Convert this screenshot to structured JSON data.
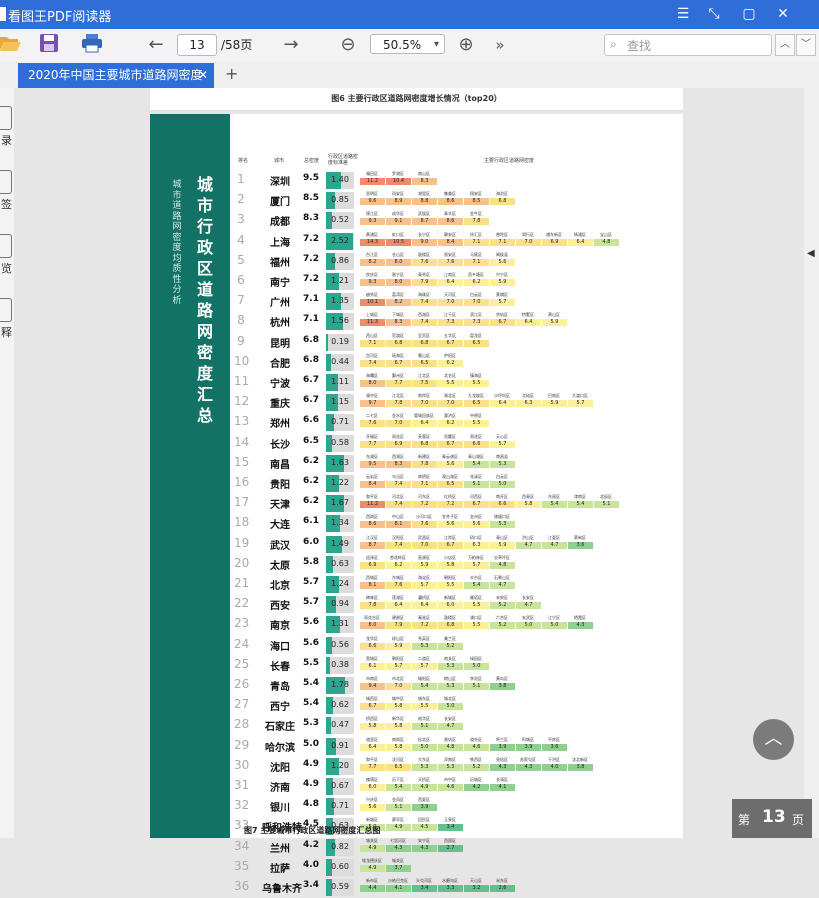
{
  "window": {
    "title": "看图王PDF阅读器",
    "minimize": "☰",
    "restore": "⤡",
    "maximize": "▢",
    "close": "✕"
  },
  "toolbar": {
    "open_icon": "folder-open-icon",
    "save_icon": "save-icon",
    "print_icon": "printer-icon",
    "back_glyph": "←",
    "forward_glyph": "→",
    "page_current": "13",
    "page_total": "/58页",
    "zoom_out_glyph": "⊖",
    "zoom_value": "50.5%",
    "zoom_caret": "▾",
    "zoom_in_glyph": "⊕",
    "more_glyph": "»",
    "search_placeholder": "查找",
    "search_glyph": "⌕",
    "search_prev": "︿",
    "search_next": "﹀"
  },
  "tabs": [
    {
      "label": "2020年中国主要城市道路网密度",
      "close": "✕"
    }
  ],
  "new_tab": "+",
  "sidebar": {
    "items": [
      {
        "label": "录"
      },
      {
        "label": "签"
      },
      {
        "label": "览"
      },
      {
        "label": "释"
      }
    ]
  },
  "document": {
    "upper_caption": "图6 主要行政区道路网密度增长情况（top20）",
    "band_title": "城市行政区道路网密度汇总",
    "band_subtitle": "城市道路网密度均质性分析",
    "headers": {
      "rank": "排名",
      "city": "城市",
      "total": "总密度",
      "dev": "行政区道路密度标准差",
      "districts": "主要行政区道路网密度"
    },
    "next_caption": "图7 主要城市行政区道路网密度汇总图",
    "rows": [
      {
        "rank": "1",
        "city": "深圳",
        "total": "9.5",
        "dev": "1.40",
        "districts": [
          [
            "福田区",
            "11.2"
          ],
          [
            "罗湖区",
            "10.4"
          ],
          [
            "南山区",
            "8.3"
          ]
        ]
      },
      {
        "rank": "2",
        "city": "厦门",
        "total": "8.5",
        "dev": "0.85",
        "districts": [
          [
            "思明区",
            "9.6"
          ],
          [
            "同安区",
            "8.9"
          ],
          [
            "湖里区",
            "8.8"
          ],
          [
            "集美区",
            "8.6"
          ],
          [
            "翔安区",
            "8.5"
          ],
          [
            "海沧区",
            "6.8"
          ]
        ]
      },
      {
        "rank": "3",
        "city": "成都",
        "total": "8.3",
        "dev": "0.52",
        "districts": [
          [
            "锦江区",
            "9.3"
          ],
          [
            "成华区",
            "9.1"
          ],
          [
            "武侯区",
            "8.7"
          ],
          [
            "青羊区",
            "8.6"
          ],
          [
            "金牛区",
            "7.8"
          ]
        ]
      },
      {
        "rank": "4",
        "city": "上海",
        "total": "7.2",
        "dev": "2.52",
        "districts": [
          [
            "黄浦区",
            "14.3"
          ],
          [
            "虹口区",
            "10.5"
          ],
          [
            "长宁区",
            "9.0"
          ],
          [
            "静安区",
            "8.4"
          ],
          [
            "徐汇区",
            "7.1"
          ],
          [
            "普陀区",
            "7.1"
          ],
          [
            "闵行区",
            "7.0"
          ],
          [
            "浦东新区",
            "6.9"
          ],
          [
            "杨浦区",
            "6.4"
          ],
          [
            "宝山区",
            "4.8"
          ]
        ]
      },
      {
        "rank": "5",
        "city": "福州",
        "total": "7.2",
        "dev": "0.86",
        "districts": [
          [
            "台江区",
            "8.2"
          ],
          [
            "仓山区",
            "8.0"
          ],
          [
            "鼓楼区",
            "7.6"
          ],
          [
            "晋安区",
            "7.6"
          ],
          [
            "马尾区",
            "7.1"
          ],
          [
            "闽侯县",
            "5.6"
          ]
        ]
      },
      {
        "rank": "6",
        "city": "南宁",
        "total": "7.2",
        "dev": "1.21",
        "districts": [
          [
            "良庆区",
            "9.3"
          ],
          [
            "邕宁区",
            "8.0"
          ],
          [
            "青秀区",
            "7.9"
          ],
          [
            "江南区",
            "6.4"
          ],
          [
            "西乡塘区",
            "6.2"
          ],
          [
            "兴宁区",
            "5.9"
          ]
        ]
      },
      {
        "rank": "7",
        "city": "广州",
        "total": "7.1",
        "dev": "1.35",
        "districts": [
          [
            "越秀区",
            "10.1"
          ],
          [
            "荔湾区",
            "8.2"
          ],
          [
            "海珠区",
            "7.4"
          ],
          [
            "天河区",
            "7.0"
          ],
          [
            "白云区",
            "7.0"
          ],
          [
            "黄埔区",
            "5.7"
          ]
        ]
      },
      {
        "rank": "8",
        "city": "杭州",
        "total": "7.1",
        "dev": "1.56",
        "districts": [
          [
            "上城区",
            "11.3"
          ],
          [
            "下城区",
            "8.3"
          ],
          [
            "西湖区",
            "7.4"
          ],
          [
            "江干区",
            "7.3"
          ],
          [
            "滨江区",
            "7.3"
          ],
          [
            "余杭区",
            "6.7"
          ],
          [
            "拱墅区",
            "6.4"
          ],
          [
            "萧山区",
            "5.9"
          ]
        ]
      },
      {
        "rank": "9",
        "city": "昆明",
        "total": "6.8",
        "dev": "0.19",
        "districts": [
          [
            "西山区",
            "7.1"
          ],
          [
            "官渡区",
            "6.8"
          ],
          [
            "呈贡区",
            "6.8"
          ],
          [
            "五华区",
            "6.7"
          ],
          [
            "盘龙区",
            "6.5"
          ]
        ]
      },
      {
        "rank": "10",
        "city": "合肥",
        "total": "6.8",
        "dev": "0.44",
        "districts": [
          [
            "包河区",
            "7.4"
          ],
          [
            "瑶海区",
            "6.7"
          ],
          [
            "蜀山区",
            "6.5"
          ],
          [
            "庐阳区",
            "6.2"
          ]
        ]
      },
      {
        "rank": "11",
        "city": "宁波",
        "total": "6.7",
        "dev": "1.11",
        "districts": [
          [
            "海曙区",
            "8.0"
          ],
          [
            "鄞州区",
            "7.7"
          ],
          [
            "江北区",
            "7.5"
          ],
          [
            "北仑区",
            "5.5"
          ],
          [
            "镇海区",
            "5.5"
          ]
        ]
      },
      {
        "rank": "12",
        "city": "重庆",
        "total": "6.7",
        "dev": "1.15",
        "districts": [
          [
            "渝中区",
            "9.7"
          ],
          [
            "江北区",
            "7.8"
          ],
          [
            "南岸区",
            "7.0"
          ],
          [
            "渝北区",
            "7.0"
          ],
          [
            "九龙坡区",
            "6.5"
          ],
          [
            "沙坪坝区",
            "6.4"
          ],
          [
            "北碚区",
            "6.3"
          ],
          [
            "巴南区",
            "5.9"
          ],
          [
            "大渡口区",
            "5.7"
          ]
        ]
      },
      {
        "rank": "13",
        "city": "郑州",
        "total": "6.6",
        "dev": "0.71",
        "districts": [
          [
            "二七区",
            "7.6"
          ],
          [
            "金水区",
            "7.0"
          ],
          [
            "管城回族区",
            "6.4"
          ],
          [
            "惠济区",
            "6.2"
          ],
          [
            "中原区",
            "5.5"
          ]
        ]
      },
      {
        "rank": "14",
        "city": "长沙",
        "total": "6.5",
        "dev": "0.58",
        "districts": [
          [
            "开福区",
            "7.7"
          ],
          [
            "雨花区",
            "6.9"
          ],
          [
            "芙蓉区",
            "6.8"
          ],
          [
            "岳麓区",
            "6.7"
          ],
          [
            "雨花区",
            "6.6"
          ],
          [
            "天心区",
            "5.7"
          ]
        ]
      },
      {
        "rank": "15",
        "city": "南昌",
        "total": "6.2",
        "dev": "1.63",
        "districts": [
          [
            "东湖区",
            "9.5"
          ],
          [
            "西湖区",
            "8.3"
          ],
          [
            "新建区",
            "7.8"
          ],
          [
            "青云谱区",
            "5.6"
          ],
          [
            "青山湖区",
            "5.4"
          ],
          [
            "南昌县",
            "5.3"
          ]
        ]
      },
      {
        "rank": "16",
        "city": "贵阳",
        "total": "6.2",
        "dev": "1.22",
        "districts": [
          [
            "云岩区",
            "8.4"
          ],
          [
            "乌当区",
            "7.4"
          ],
          [
            "南明区",
            "7.1"
          ],
          [
            "观山湖区",
            "6.5"
          ],
          [
            "花溪区",
            "5.1"
          ],
          [
            "白云区",
            "5.0"
          ]
        ]
      },
      {
        "rank": "17",
        "city": "天津",
        "total": "6.2",
        "dev": "1.67",
        "districts": [
          [
            "和平区",
            "11.2"
          ],
          [
            "河北区",
            "7.4"
          ],
          [
            "河东区",
            "7.2"
          ],
          [
            "红桥区",
            "7.2"
          ],
          [
            "河西区",
            "6.7"
          ],
          [
            "南开区",
            "6.6"
          ],
          [
            "西青区",
            "5.8"
          ],
          [
            "东丽区",
            "5.4"
          ],
          [
            "津南区",
            "5.4"
          ],
          [
            "北辰区",
            "5.1"
          ]
        ]
      },
      {
        "rank": "18",
        "city": "大连",
        "total": "6.1",
        "dev": "1.34",
        "districts": [
          [
            "西岗区",
            "8.6"
          ],
          [
            "中山区",
            "8.1"
          ],
          [
            "沙河口区",
            "7.6"
          ],
          [
            "甘井子区",
            "5.6"
          ],
          [
            "金州区",
            "5.6"
          ],
          [
            "旅顺口区",
            "5.3"
          ]
        ]
      },
      {
        "rank": "19",
        "city": "武汉",
        "total": "6.0",
        "dev": "1.49",
        "districts": [
          [
            "江汉区",
            "8.7"
          ],
          [
            "汉阳区",
            "7.4"
          ],
          [
            "武昌区",
            "7.0"
          ],
          [
            "江岸区",
            "6.7"
          ],
          [
            "硚口区",
            "6.3"
          ],
          [
            "青山区",
            "5.9"
          ],
          [
            "洪山区",
            "4.7"
          ],
          [
            "江夏区",
            "4.7"
          ],
          [
            "蔡甸区",
            "3.6"
          ]
        ]
      },
      {
        "rank": "20",
        "city": "太原",
        "total": "5.8",
        "dev": "0.63",
        "districts": [
          [
            "迎泽区",
            "6.9"
          ],
          [
            "杏花岭区",
            "6.2"
          ],
          [
            "晋源区",
            "5.9"
          ],
          [
            "小店区",
            "5.8"
          ],
          [
            "万柏林区",
            "5.7"
          ],
          [
            "尖草坪区",
            "4.8"
          ]
        ]
      },
      {
        "rank": "21",
        "city": "北京",
        "total": "5.7",
        "dev": "1.24",
        "districts": [
          [
            "西城区",
            "8.1"
          ],
          [
            "东城区",
            "7.6"
          ],
          [
            "海淀区",
            "5.7"
          ],
          [
            "朝阳区",
            "5.5"
          ],
          [
            "丰台区",
            "5.4"
          ],
          [
            "石景山区",
            "4.7"
          ]
        ]
      },
      {
        "rank": "22",
        "city": "西安",
        "total": "5.7",
        "dev": "0.94",
        "districts": [
          [
            "碑林区",
            "7.8"
          ],
          [
            "莲湖区",
            "6.4"
          ],
          [
            "灞桥区",
            "6.4"
          ],
          [
            "新城区",
            "6.0"
          ],
          [
            "雁塔区",
            "5.5"
          ],
          [
            "未央区",
            "5.2"
          ],
          [
            "长安区",
            "4.7"
          ]
        ]
      },
      {
        "rank": "23",
        "city": "南京",
        "total": "5.6",
        "dev": "1.31",
        "districts": [
          [
            "雨花台区",
            "8.0"
          ],
          [
            "建邺区",
            "7.9"
          ],
          [
            "秦淮区",
            "7.2"
          ],
          [
            "鼓楼区",
            "6.8"
          ],
          [
            "浦口区",
            "5.5"
          ],
          [
            "六合区",
            "5.2"
          ],
          [
            "玄武区",
            "5.0"
          ],
          [
            "江宁区",
            "5.0"
          ],
          [
            "栖霞区",
            "4.3"
          ]
        ]
      },
      {
        "rank": "24",
        "city": "海口",
        "total": "5.6",
        "dev": "0.56",
        "districts": [
          [
            "龙华区",
            "6.6"
          ],
          [
            "琼山区",
            "5.9"
          ],
          [
            "秀英区",
            "5.3"
          ],
          [
            "美兰区",
            "5.2"
          ]
        ]
      },
      {
        "rank": "25",
        "city": "长春",
        "total": "5.5",
        "dev": "0.38",
        "districts": [
          [
            "宽城区",
            "6.1"
          ],
          [
            "朝阳区",
            "5.7"
          ],
          [
            "二道区",
            "5.7"
          ],
          [
            "南关区",
            "5.3"
          ],
          [
            "绿园区",
            "5.0"
          ]
        ]
      },
      {
        "rank": "26",
        "city": "青岛",
        "total": "5.4",
        "dev": "1.78",
        "districts": [
          [
            "市南区",
            "9.4"
          ],
          [
            "市北区",
            "7.0"
          ],
          [
            "城阳区",
            "5.4"
          ],
          [
            "崂山区",
            "5.3"
          ],
          [
            "李沧区",
            "5.1"
          ],
          [
            "黄岛区",
            "3.8"
          ]
        ]
      },
      {
        "rank": "27",
        "city": "西宁",
        "total": "5.4",
        "dev": "0.62",
        "districts": [
          [
            "城西区",
            "6.7"
          ],
          [
            "城中区",
            "5.8"
          ],
          [
            "城东区",
            "5.5"
          ],
          [
            "城北区",
            "5.0"
          ]
        ]
      },
      {
        "rank": "28",
        "city": "石家庄",
        "total": "5.3",
        "dev": "0.47",
        "districts": [
          [
            "桥西区",
            "5.8"
          ],
          [
            "新华区",
            "5.8"
          ],
          [
            "裕华区",
            "5.1"
          ],
          [
            "长安区",
            "4.7"
          ]
        ]
      },
      {
        "rank": "29",
        "city": "哈尔滨",
        "total": "5.0",
        "dev": "0.91",
        "districts": [
          [
            "道里区",
            "6.4"
          ],
          [
            "南岗区",
            "5.8"
          ],
          [
            "松北区",
            "5.0"
          ],
          [
            "香坊区",
            "4.8"
          ],
          [
            "道外区",
            "4.6"
          ],
          [
            "呼兰区",
            "3.9"
          ],
          [
            "阿城区",
            "3.9"
          ],
          [
            "平房区",
            "3.6"
          ]
        ]
      },
      {
        "rank": "30",
        "city": "沈阳",
        "total": "4.9",
        "dev": "1.20",
        "districts": [
          [
            "和平区",
            "7.7"
          ],
          [
            "沈河区",
            "6.5"
          ],
          [
            "大东区",
            "5.3"
          ],
          [
            "浑南区",
            "5.3"
          ],
          [
            "铁西区",
            "5.2"
          ],
          [
            "皇姑区",
            "4.3"
          ],
          [
            "苏家屯区",
            "4.3"
          ],
          [
            "于洪区",
            "4.0"
          ],
          [
            "沈北新区",
            "3.8"
          ]
        ]
      },
      {
        "rank": "31",
        "city": "济南",
        "total": "4.9",
        "dev": "0.67",
        "districts": [
          [
            "槐荫区",
            "6.0"
          ],
          [
            "历下区",
            "5.4"
          ],
          [
            "天桥区",
            "4.9"
          ],
          [
            "市中区",
            "4.6"
          ],
          [
            "历城区",
            "4.2"
          ],
          [
            "长清区",
            "4.1"
          ]
        ]
      },
      {
        "rank": "32",
        "city": "银川",
        "total": "4.8",
        "dev": "0.71",
        "districts": [
          [
            "兴庆区",
            "5.6"
          ],
          [
            "金凤区",
            "5.1"
          ],
          [
            "西夏区",
            "3.9"
          ]
        ]
      },
      {
        "rank": "33",
        "city": "呼和浩特",
        "total": "4.5",
        "dev": "0.63",
        "districts": [
          [
            "新城区",
            "5.0"
          ],
          [
            "赛罕区",
            "4.9"
          ],
          [
            "回民区",
            "4.5"
          ],
          [
            "玉泉区",
            "3.4"
          ]
        ]
      },
      {
        "rank": "34",
        "city": "兰州",
        "total": "4.2",
        "dev": "0.82",
        "districts": [
          [
            "城关区",
            "4.9"
          ],
          [
            "七里河区",
            "4.3"
          ],
          [
            "安宁区",
            "4.3"
          ],
          [
            "西固区",
            "2.7"
          ]
        ]
      },
      {
        "rank": "35",
        "city": "拉萨",
        "total": "4.0",
        "dev": "0.60",
        "districts": [
          [
            "堆龙德庆区",
            "4.9"
          ],
          [
            "城关区",
            "3.7"
          ]
        ]
      },
      {
        "rank": "36",
        "city": "乌鲁木齐",
        "total": "3.4",
        "dev": "0.59",
        "districts": [
          [
            "新市区",
            "4.4"
          ],
          [
            "沙依巴克区",
            "4.1"
          ],
          [
            "头屯河区",
            "3.4"
          ],
          [
            "水磨沟区",
            "3.3"
          ],
          [
            "天山区",
            "3.2"
          ],
          [
            "米东区",
            "2.6"
          ]
        ]
      }
    ]
  },
  "page_badge": {
    "prefix": "第",
    "number": "13",
    "suffix": "页"
  },
  "back_to_top": "︿"
}
